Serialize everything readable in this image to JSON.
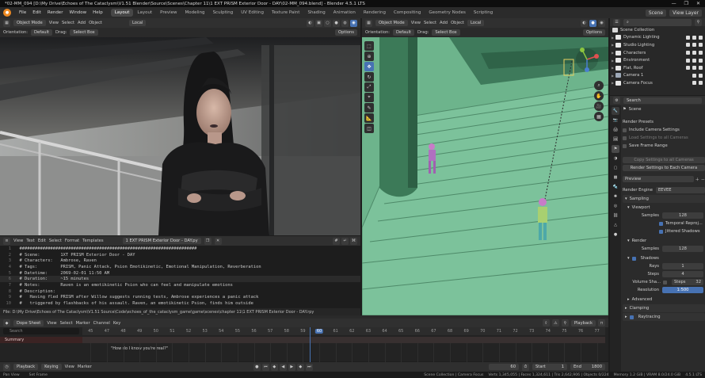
{
  "window": {
    "title": "*02-MM_094 [D:\\My Drive\\Echoes of The Cataclysm\\V1.51 Blender\\Source\\Scenes\\Chapter 11\\1 EXT PRISM Exterior Door - DAY\\02-MM_094.blend] - Blender 4.5.1 LTS",
    "min": "—",
    "max": "❐",
    "close": "✕"
  },
  "menubar": {
    "menus": [
      "File",
      "Edit",
      "Render",
      "Window",
      "Help"
    ],
    "workspaces": [
      "Layout",
      "Layout",
      "Preview",
      "Modeling",
      "Sculpting",
      "UV Editing",
      "Texture Paint",
      "Shading",
      "Animation",
      "Rendering",
      "Compositing",
      "Geometry Nodes",
      "Scripting"
    ],
    "active_workspace": 0,
    "scene": "Scene",
    "view_layer": "View Layer"
  },
  "left_viewport_header": {
    "orientation_label": "Orientation:",
    "orientation": "Default",
    "drag_label": "Drag:",
    "drag": "Select Box",
    "mode": "Object Mode",
    "menus": [
      "View",
      "Select",
      "Add",
      "Object"
    ],
    "transform": "Local",
    "options": "Options"
  },
  "right_viewport_header": {
    "orientation_label": "Orientation:",
    "orientation": "Default",
    "drag_label": "Drag:",
    "drag": "Select Box",
    "mode": "Object Mode",
    "menus": [
      "View",
      "Select",
      "Add",
      "Object"
    ],
    "transform": "Local",
    "options": "Options"
  },
  "text_editor": {
    "menus": [
      "View",
      "Text",
      "Edit",
      "Select",
      "Format",
      "Templates"
    ],
    "filename": "1 EXT PRISM Exterior Door - DAY.py",
    "lines": [
      {
        "n": "1",
        "t": "  #####################################################################"
      },
      {
        "n": "2",
        "t": "  # Scene:        1XT PRISM Exterior Door - DAY"
      },
      {
        "n": "3",
        "t": "  # Characters:   Ambrose, Raven"
      },
      {
        "n": "4",
        "t": "  # Tags:         PRISM, Panic Attack, Psion Emotikinetic, Emotional Manipulation, Reverberation"
      },
      {
        "n": "5",
        "t": "  # Datetime:     2069-02-01 11:50 AM"
      },
      {
        "n": "6",
        "t": "  # Duration:     ~15 minutes"
      },
      {
        "n": "7",
        "t": "  # Notes:        Raven is an emotikinetic Psion who can feel and manipulate emotions"
      },
      {
        "n": "8",
        "t": "  # Description:"
      },
      {
        "n": "9",
        "t": "  #   Having fled PRISM after Willow suggests running tests, Ambrose experiences a panic attack"
      },
      {
        "n": "10",
        "t": "  #   triggered by flashbacks of his assault. Raven, an emotikinetic Psion, finds him outside"
      },
      {
        "n": "11",
        "t": "  #   and attempts to calm his overwhelming emotions. Through their charged exchange filled with"
      }
    ],
    "current_line": 5,
    "status": "File: D:\\My Drive\\Echoes of The Cataclysm\\V1.51 Source\\Code\\echoes_of_the_cataclysm_game\\game\\scenes\\chapter 11\\1 EXT PRISM Exterior Door - DAY.rpy"
  },
  "outliner": {
    "header": "Scene Collection",
    "items": [
      {
        "label": "Dynamic Lighting",
        "color": "#e8e8e8"
      },
      {
        "label": "Studio Lighting",
        "color": "#e8e8e8"
      },
      {
        "label": "Characters",
        "color": "#e8e8e8"
      },
      {
        "label": "Environment",
        "color": "#e8e8e8"
      },
      {
        "label": "Flat, Roof",
        "color": "#e8e8e8"
      },
      {
        "label": "Camera 1",
        "color": "#9ea9b8"
      },
      {
        "label": "Camera Focus",
        "color": "#e8e8e8"
      }
    ]
  },
  "properties": {
    "search_placeholder": "Search",
    "context": "Scene",
    "render_presets": "Render Presets",
    "include_camera_settings": "Include Camera Settings",
    "load_settings_all_cameras": "Load Settings to all Cameras",
    "save_frame_range": "Save Frame Range",
    "copy_settings_all_cameras": "Copy Settings to all Cameras",
    "render_settings_to_cam": "Render Settings to Each Camera",
    "preview": "Preview",
    "render_engine_label": "Render Engine",
    "render_engine": "EEVEE",
    "sampling": "Sampling",
    "viewport": "Viewport",
    "samples_label": "Samples",
    "viewport_samples": "128",
    "temporal_reprojection": "Temporal Reproj...",
    "jittered_shadows": "Jittered Shadows",
    "render": "Render",
    "render_samples": "128",
    "shadows": "Shadows",
    "rays_label": "Rays",
    "rays": "1",
    "steps_label": "Steps",
    "steps": "4",
    "volume_shadows": "Volume Sha...",
    "volume_steps": "Steps",
    "volume_steps_val": "32",
    "resolution_label": "Resolution",
    "resolution": "1:500",
    "advanced": "Advanced",
    "clamping": "Clamping",
    "raytracing": "Raytracing"
  },
  "dopesheet": {
    "mode": "Dope Sheet",
    "menus": [
      "View",
      "Select",
      "Marker",
      "Channel",
      "Key"
    ],
    "summary": "Summary",
    "search_placeholder": "Search",
    "playback_label": "Playback",
    "frames": [
      "45",
      "47",
      "48",
      "49",
      "50",
      "51",
      "52",
      "53",
      "54",
      "55",
      "56",
      "57",
      "58",
      "59",
      "60",
      "61",
      "62",
      "63",
      "64",
      "65",
      "66",
      "67",
      "68",
      "69",
      "70",
      "71",
      "72",
      "73",
      "74",
      "75",
      "76",
      "77"
    ],
    "current_frame": "60",
    "marker_text": "\"How do I know you're real?\""
  },
  "timeline": {
    "menus": [
      "Playback",
      "Keying",
      "View",
      "Marker"
    ],
    "current": "60",
    "start_label": "Start",
    "start": "1",
    "end_label": "End",
    "end": "1800"
  },
  "status_bar": {
    "left": "Pan View",
    "left2": "Set Frame",
    "collection": "Scene Collection | Camera Focus",
    "verts": "Verts 1,345,055 | Faces 1,324,611 | Tris 2,642,906 | Objects 0/224",
    "memory": "Memory 1.2 GiB | VRAM 8.0/24.0 GiB",
    "version": "4.5.1 LTS"
  },
  "colors": {
    "accent": "#4772b3",
    "viewport_bg": "#65a884",
    "blender_orange": "#ee8a22"
  }
}
